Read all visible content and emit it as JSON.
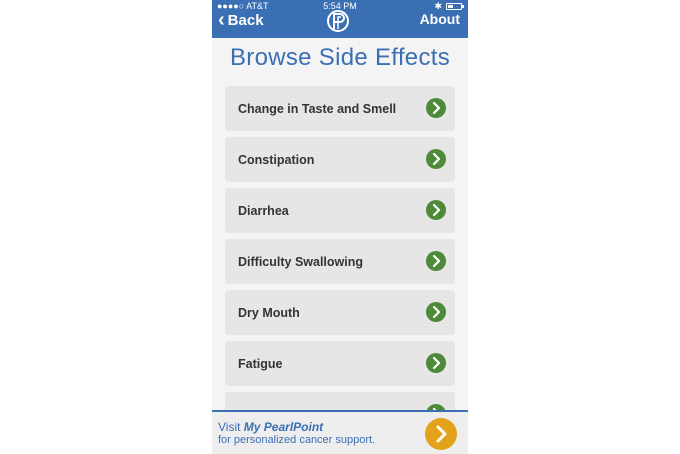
{
  "status_bar": {
    "carrier": "●●●●○ AT&T",
    "time": "5:54 PM",
    "icons": [
      "wifi-icon",
      "bluetooth-icon",
      "battery-icon"
    ]
  },
  "nav": {
    "back_label": "Back",
    "about_label": "About",
    "logo": "pearlpoint-logo-icon"
  },
  "title": "Browse Side Effects",
  "items": [
    {
      "label": "Change in Taste and Smell"
    },
    {
      "label": "Constipation"
    },
    {
      "label": "Diarrhea"
    },
    {
      "label": "Difficulty Swallowing"
    },
    {
      "label": "Dry Mouth"
    },
    {
      "label": "Fatigue"
    }
  ],
  "footer": {
    "visit": "Visit",
    "brand": "My PearlPoint",
    "subtitle": "for personalized cancer support."
  },
  "colors": {
    "nav_blue": "#3b6fb4",
    "go_green": "#4e8a3a",
    "cta_gold": "#e3a21c",
    "item_bg": "#e6e6e6"
  }
}
